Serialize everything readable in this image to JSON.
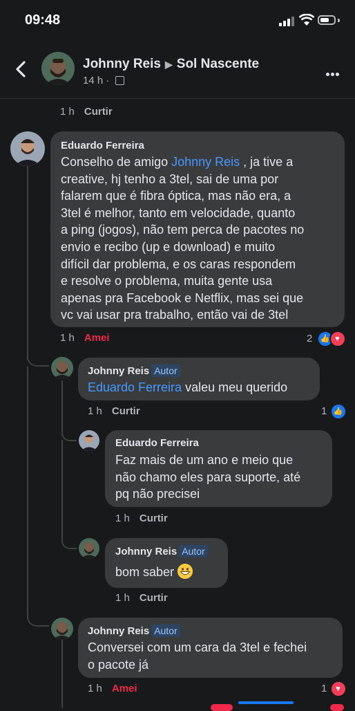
{
  "status": {
    "time": "09:48"
  },
  "header": {
    "author": "Johnny Reis",
    "group": "Sol Nascente",
    "time": "14 h"
  },
  "top_meta": {
    "time": "1 h",
    "action": "Curtir"
  },
  "comments": [
    {
      "author": "Eduardo Ferreira",
      "badge": "",
      "text_before": "Conselho de amigo ",
      "mention": "Johnny Reis",
      "text_lines": [
        " , ja tive a",
        "creative, hj tenho a 3tel, sai de uma por",
        "falarem que é fibra óptica, mas não era, a",
        "3tel é melhor, tanto em velocidade, quanto",
        "a ping (jogos), não tem perca de pacotes no",
        "envio e recibo (up e download) e muito",
        "difícil dar problema, e os caras respondem",
        "e resolve o problema, muita gente usa",
        "apenas pra Facebook e Netflix, mas sei que",
        "vc vai usar pra trabalho, então vai de 3tel"
      ],
      "time": "1 h",
      "action": "Amei",
      "reaction_count": "2"
    },
    {
      "author": "Johnny Reis",
      "badge": "Autor",
      "mention": "Eduardo Ferreira",
      "text": " valeu meu querido",
      "time": "1 h",
      "action": "Curtir",
      "reaction_count": "1"
    },
    {
      "author": "Eduardo Ferreira",
      "badge": "",
      "text_lines": [
        "Faz mais de um ano e meio que",
        "não chamo eles para suporte, até",
        "pq não precisei"
      ],
      "time": "1 h",
      "action": "Curtir"
    },
    {
      "author": "Johnny Reis",
      "badge": "Autor",
      "text": "bom saber",
      "emoji": "grinning-face",
      "time": "1 h",
      "action": "Curtir"
    },
    {
      "author": "Johnny Reis",
      "badge": "Autor",
      "text_lines": [
        "Conversei com um cara da 3tel e fechei",
        "o pacote já"
      ],
      "time": "1 h",
      "action": "Amei",
      "reaction_count": "1"
    }
  ],
  "colors": {
    "background": "#18191a",
    "bubble": "#3a3b3c",
    "mention": "#4599ff",
    "love": "#f02849",
    "like": "#1877f2"
  }
}
